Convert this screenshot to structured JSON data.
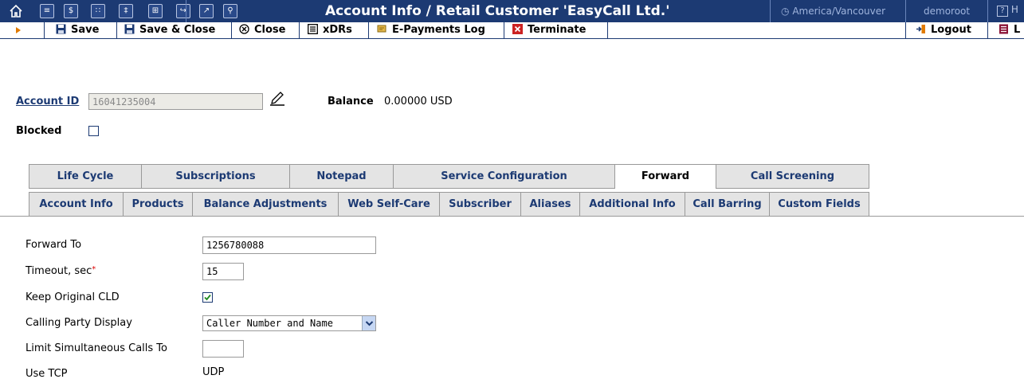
{
  "header": {
    "title": "Account Info / Retail Customer 'EasyCall Ltd.'",
    "timezone": "America/Vancouver",
    "user": "demoroot",
    "help_label": "H",
    "icons": [
      "home-icon",
      "list-icon",
      "dollar-icon",
      "group-icon",
      "person-icon",
      "grid-icon",
      "forward-icon",
      "chart-icon",
      "search-icon"
    ]
  },
  "toolbar": {
    "save": "Save",
    "save_close": "Save & Close",
    "close": "Close",
    "xdrs": "xDRs",
    "epayments": "E-Payments Log",
    "terminate": "Terminate",
    "logout": "Logout",
    "last_label": "L"
  },
  "account": {
    "id_label": "Account ID",
    "id_value": "16041235004",
    "balance_label": "Balance",
    "balance_value": "0.00000 USD",
    "blocked_label": "Blocked",
    "blocked": false
  },
  "tabs": {
    "row1": [
      "Life Cycle",
      "Subscriptions",
      "Notepad",
      "Service Configuration",
      "Forward",
      "Call Screening"
    ],
    "row2": [
      "Account Info",
      "Products",
      "Balance Adjustments",
      "Web Self-Care",
      "Subscriber",
      "Aliases",
      "Additional Info",
      "Call Barring",
      "Custom Fields"
    ],
    "active": "Forward"
  },
  "form": {
    "forward_to_label": "Forward To",
    "forward_to_value": "1256780088",
    "timeout_label": "Timeout, sec",
    "timeout_required_mark": "*",
    "timeout_value": "15",
    "keep_cld_label": "Keep Original CLD",
    "keep_cld_checked": true,
    "calling_party_label": "Calling Party Display",
    "calling_party_value": "Caller Number and Name",
    "limit_calls_label": "Limit Simultaneous Calls To",
    "limit_calls_value": "",
    "use_tcp_label": "Use TCP",
    "use_tcp_value": "UDP"
  },
  "colors": {
    "header_bg": "#1c3a73",
    "tab_text": "#1c3a73",
    "tab_bg": "#e4e4e4",
    "terminate_red": "#cc2222",
    "accent_orange": "#e07a00"
  }
}
